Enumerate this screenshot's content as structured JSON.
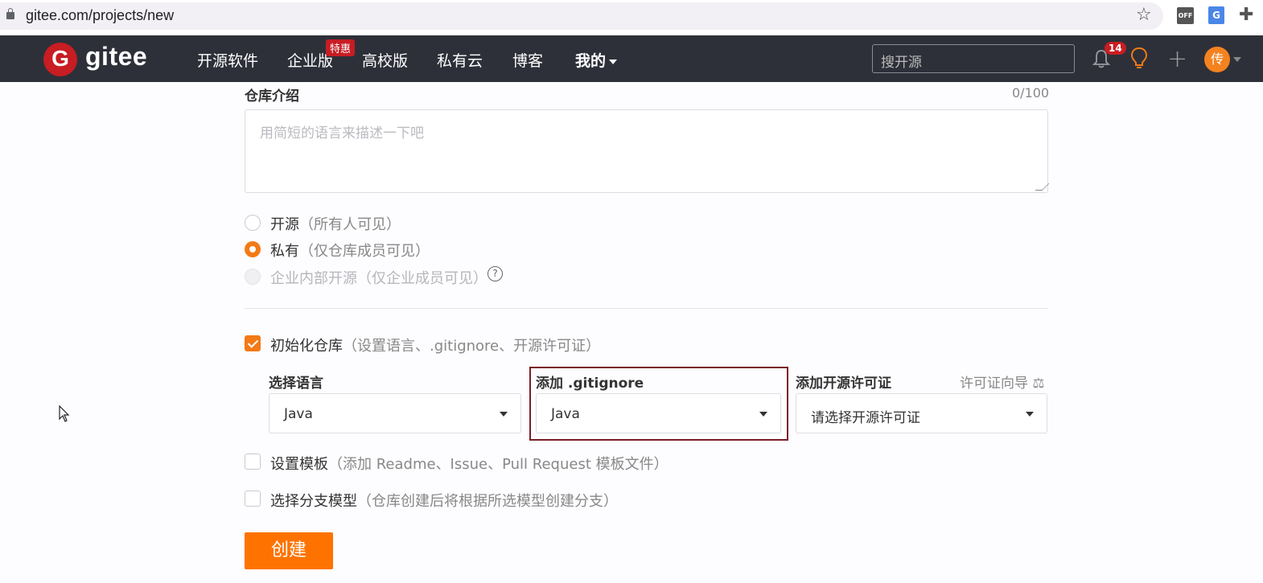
{
  "browser": {
    "url": "gitee.com/projects/new",
    "ext_off_label": "OFF",
    "ext_translate_label": "G"
  },
  "nav": {
    "logo_letter": "G",
    "logo_text": "gitee",
    "items": [
      "开源软件",
      "企业版",
      "高校版",
      "私有云",
      "博客",
      "我的"
    ],
    "hot_badge": "特惠",
    "search_placeholder": "搜开源",
    "notification_count": "14",
    "avatar_text": "传",
    "brand_color": "#c71d23",
    "bg_color": "#2e3039"
  },
  "form": {
    "intro_label": "仓库介绍",
    "intro_counter": "0/100",
    "intro_placeholder": "用简短的语言来描述一下吧",
    "visibility": [
      {
        "label": "开源",
        "hint": "（所有人可见）",
        "state": "off"
      },
      {
        "label": "私有",
        "hint": "（仅仓库成员可见）",
        "state": "on"
      },
      {
        "label": "企业内部开源",
        "hint": "（仅企业成员可见）",
        "state": "disabled"
      }
    ],
    "help_icon_glyph": "?",
    "init_repo": {
      "label": "初始化仓库",
      "hint": "（设置语言、.gitignore、开源许可证）",
      "checked": true
    },
    "language": {
      "label": "选择语言",
      "value": "Java"
    },
    "gitignore": {
      "label": "添加 .gitignore",
      "value": "Java"
    },
    "license": {
      "label": "添加开源许可证",
      "value": "请选择开源许可证",
      "wizard": "许可证向导"
    },
    "template": {
      "label": "设置模板",
      "hint": "（添加 Readme、Issue、Pull Request 模板文件）",
      "checked": false
    },
    "branch_model": {
      "label": "选择分支模型",
      "hint": "（仓库创建后将根据所选模型创建分支）",
      "checked": false
    },
    "submit_label": "创建",
    "accent_color": "#f37a16"
  }
}
